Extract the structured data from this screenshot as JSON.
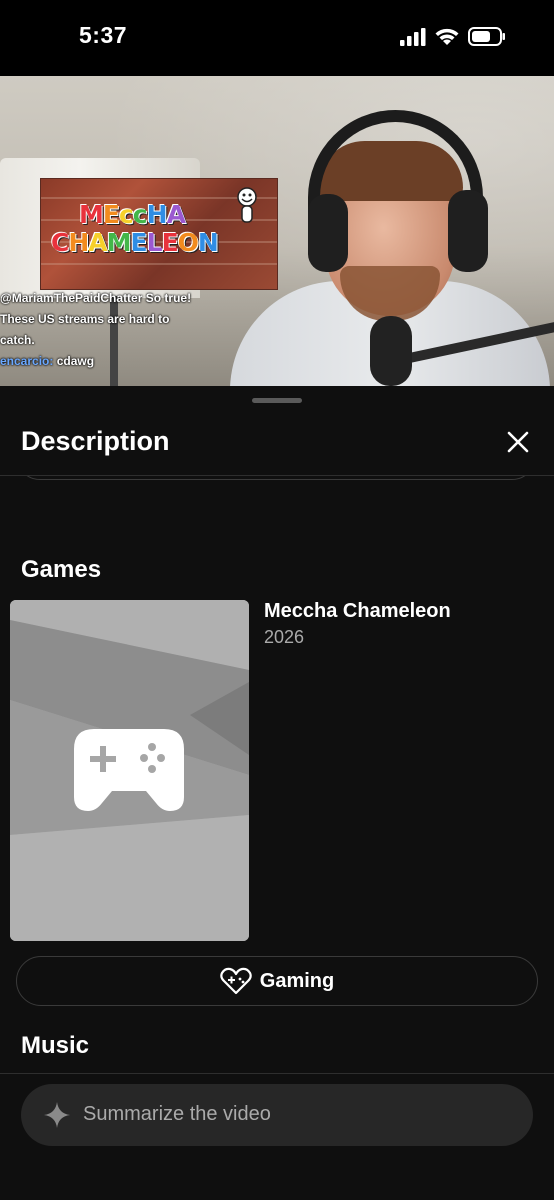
{
  "status_bar": {
    "time": "5:37",
    "icons": [
      "cellular-signal-icon",
      "wifi-icon",
      "battery-icon"
    ]
  },
  "video": {
    "game_logo": "MECCHA CHAMELEON",
    "chat": [
      {
        "user": "",
        "text": "@MariamThePaidChatter So true!"
      },
      {
        "user": "",
        "text": "These US streams are hard to"
      },
      {
        "user": "",
        "text": "catch."
      },
      {
        "user": "encarcio:",
        "text": "cdawg"
      }
    ]
  },
  "sheet": {
    "title": "Description",
    "close_icon": "close-icon",
    "games_section": {
      "title": "Games",
      "game_name": "Meccha Chameleon",
      "game_year": "2026",
      "thumbnail_icon": "gamepad-icon"
    },
    "gaming_button": {
      "label": "Gaming",
      "icon": "gaming-heart-icon"
    },
    "music_section": {
      "title": "Music"
    }
  },
  "summarize": {
    "placeholder": "Summarize the video",
    "icon": "sparkle-icon"
  },
  "colors": {
    "background": "#0f0f0f",
    "surface": "#272727",
    "text_primary": "#ffffff",
    "text_secondary": "#aaaaaa",
    "chat_username": "#6aa8ff"
  }
}
